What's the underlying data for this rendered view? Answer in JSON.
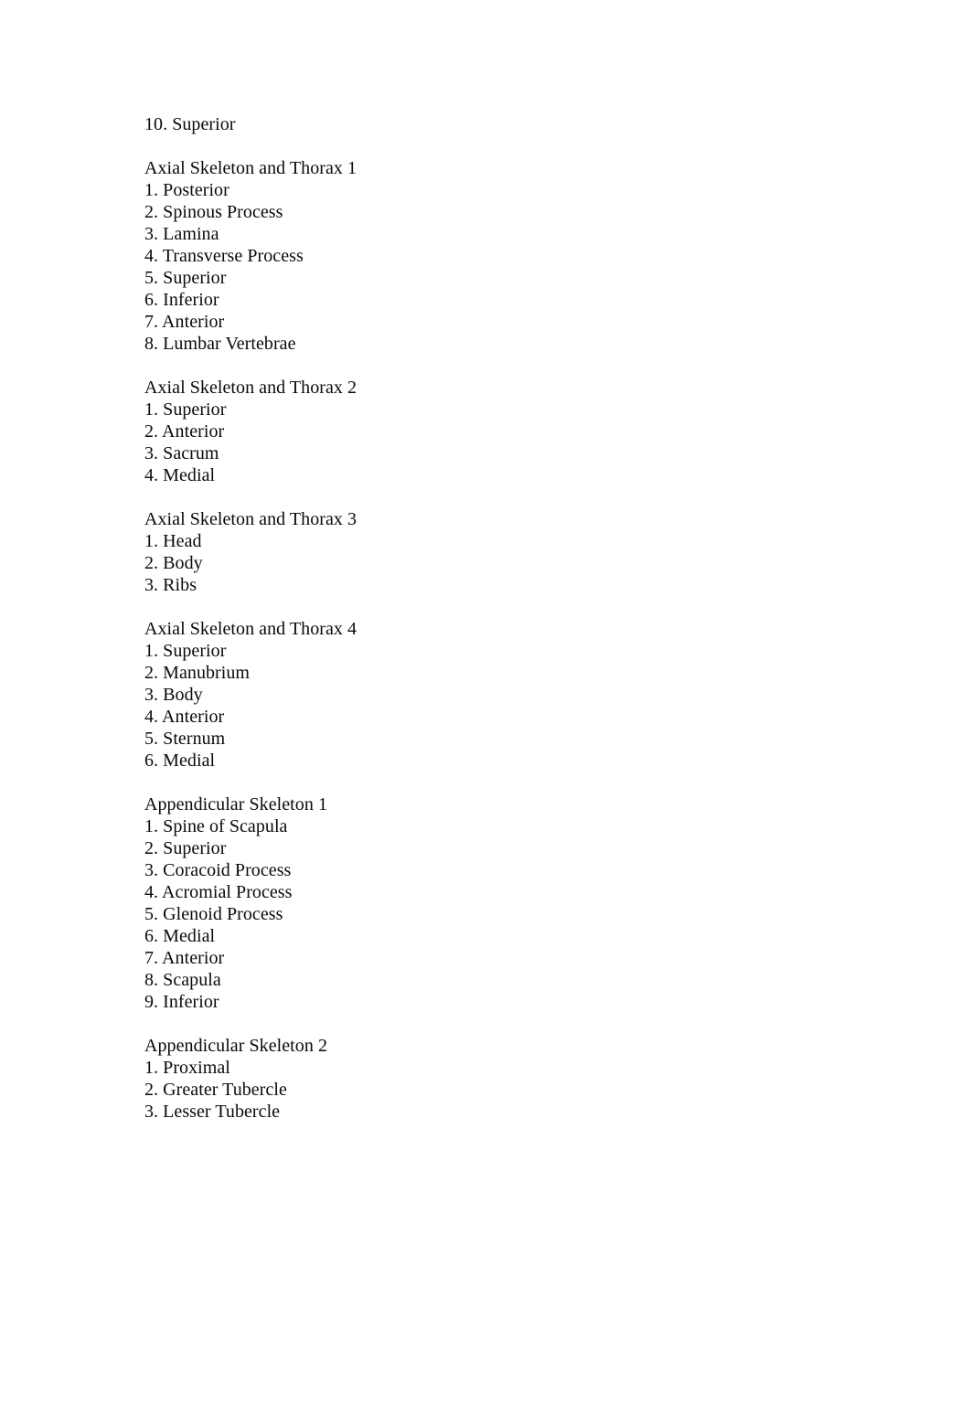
{
  "document": {
    "background_color": "#ffffff",
    "text_color": "#0a0a0a",
    "sections": [
      {
        "heading": "",
        "lines": [
          "10. Superior"
        ]
      },
      {
        "heading": "Axial Skeleton and Thorax 1",
        "lines": [
          "1. Posterior",
          "2. Spinous Process",
          "3. Lamina",
          "4. Transverse Process",
          "5. Superior",
          "6. Inferior",
          "7. Anterior",
          "8. Lumbar Vertebrae"
        ]
      },
      {
        "heading": "Axial Skeleton and Thorax 2",
        "lines": [
          "1. Superior",
          "2. Anterior",
          "3. Sacrum",
          "4. Medial"
        ]
      },
      {
        "heading": "Axial Skeleton and Thorax 3",
        "lines": [
          "1. Head",
          "2. Body",
          "3. Ribs"
        ]
      },
      {
        "heading": "Axial Skeleton and Thorax 4",
        "lines": [
          "1. Superior",
          "2. Manubrium",
          "3. Body",
          "4. Anterior",
          "5. Sternum",
          "6. Medial"
        ]
      },
      {
        "heading": "Appendicular Skeleton 1",
        "lines": [
          "1. Spine of Scapula",
          "2. Superior",
          "3. Coracoid Process",
          "4. Acromial Process",
          "5. Glenoid Process",
          "6. Medial",
          "7. Anterior",
          "8. Scapula",
          "9. Inferior"
        ]
      },
      {
        "heading": "Appendicular Skeleton 2",
        "lines": [
          "1. Proximal",
          "2. Greater Tubercle",
          "3. Lesser Tubercle"
        ]
      }
    ]
  }
}
